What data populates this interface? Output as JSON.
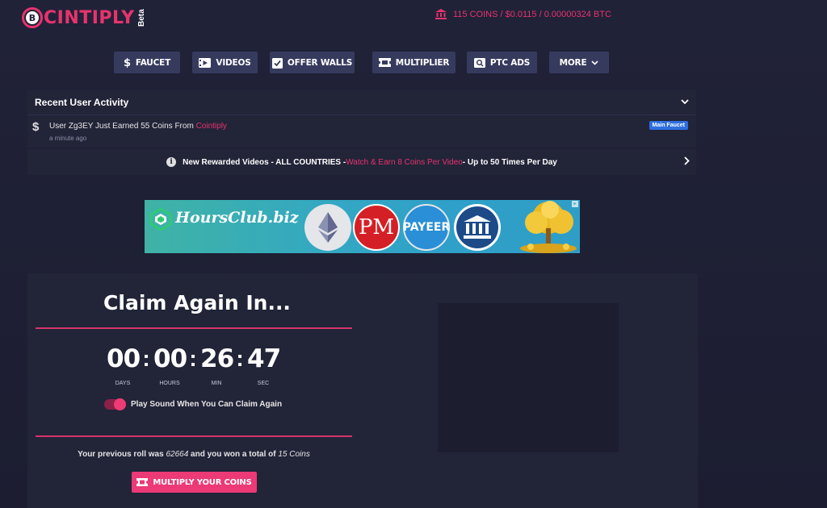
{
  "header": {
    "logo_text": "CINTIPLY",
    "logo_coin": "B",
    "logo_beta": "Beta",
    "balance": "115 COINS / $0.0115 / 0.00000324 BTC"
  },
  "nav": [
    {
      "label": "FAUCET",
      "icon": "dollar-icon"
    },
    {
      "label": "VIDEOS",
      "icon": "video-icon"
    },
    {
      "label": "OFFER WALLS",
      "icon": "checklist-icon"
    },
    {
      "label": "MULTIPLIER",
      "icon": "ticket-icon"
    },
    {
      "label": "PTC ADS",
      "icon": "search-ad-icon"
    },
    {
      "label": "MORE",
      "icon": "chevron-down-icon"
    }
  ],
  "activity": {
    "title": "Recent User Activity",
    "item": {
      "message_prefix": "User Zg3EY Just Earned 55 Coins From ",
      "message_source": "Cointiply",
      "time": "a minute ago",
      "badge": "Main Faucet"
    }
  },
  "info_bar": {
    "part1": "New Rewarded Videos - ALL COUNTRIES - ",
    "part2": "Watch & Earn 8 Coins Per Video",
    "part3": " - Up to 50 Times Per Day"
  },
  "banner": {
    "brand": "HoursClub.biz",
    "pm": "PM",
    "payeer": "PAYEER"
  },
  "claim": {
    "title": "Claim Again In...",
    "countdown": [
      {
        "value": "00",
        "label": "DAYS"
      },
      {
        "value": "00",
        "label": "HOURS"
      },
      {
        "value": "26",
        "label": "MIN"
      },
      {
        "value": "47",
        "label": "SEC"
      }
    ],
    "separator": ":",
    "sound_label": "Play Sound When You Can Claim Again",
    "sound_on": true,
    "prev_prefix": "Your previous roll was ",
    "prev_roll": "62664",
    "prev_middle": " and you won a total of ",
    "prev_total": "15 Coins",
    "multiply_label": "MULTIPLY YOUR COINS"
  },
  "colors": {
    "accent": "#e8336d",
    "nav_bg": "#363b5e",
    "panel_bg": "#222438",
    "page_bg": "#202238",
    "badge": "#2d6ee0"
  }
}
